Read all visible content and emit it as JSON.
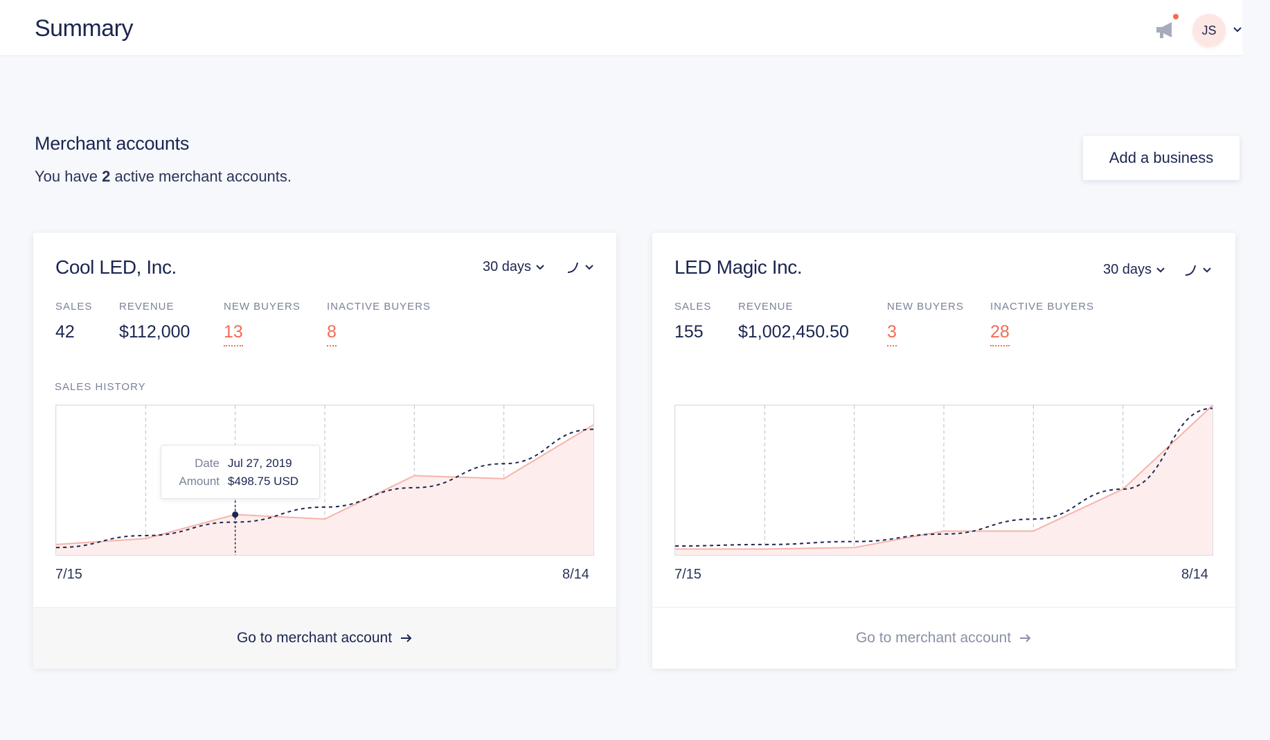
{
  "header": {
    "title": "Summary",
    "avatar_initials": "JS",
    "icons": [
      "megaphone-icon",
      "chevron-down-icon"
    ],
    "notification_color": "#f26b55"
  },
  "section": {
    "title": "Merchant accounts",
    "sub_prefix": "You have",
    "sub_count": "2",
    "sub_suffix": "active merchant accounts.",
    "add_button": "Add a business"
  },
  "colors": {
    "accent_red": "#f26b55",
    "navy": "#1b2550",
    "area_fill": "#fdeeed"
  },
  "cards": [
    {
      "name": "Cool LED, Inc.",
      "period": "30 days",
      "stats": [
        {
          "label": "SALES",
          "value": "42"
        },
        {
          "label": "REVENUE",
          "value": "$112,000"
        },
        {
          "label": "NEW BUYERS",
          "value": "13"
        },
        {
          "label": "INACTIVE BUYERS",
          "value": "8"
        }
      ],
      "history_label": "SALES HISTORY",
      "x_start": "7/15",
      "x_end": "8/14",
      "tooltip": {
        "date_label": "Date",
        "date": "Jul 27, 2019",
        "amount_label": "Amount",
        "amount": "$498.75 USD"
      },
      "footer": "Go to merchant account"
    },
    {
      "name": "LED Magic Inc.",
      "period": "30 days",
      "stats": [
        {
          "label": "SALES",
          "value": "155"
        },
        {
          "label": "REVENUE",
          "value": "$1,002,450.50"
        },
        {
          "label": "NEW BUYERS",
          "value": "3"
        },
        {
          "label": "INACTIVE BUYERS",
          "value": "28"
        }
      ],
      "x_start": "7/15",
      "x_end": "8/14",
      "footer": "Go to merchant account"
    }
  ],
  "chart_data": [
    {
      "type": "area",
      "x": [
        "7/15",
        "",
        "",
        "",
        "",
        "",
        "8/14"
      ],
      "series": [
        {
          "values": [
            0.07,
            0.11,
            0.27,
            0.24,
            0.53,
            0.51,
            0.87
          ]
        },
        {
          "values": [
            0.05,
            0.13,
            0.22,
            0.32,
            0.45,
            0.61,
            0.84
          ]
        }
      ],
      "ylim": [
        0,
        1
      ],
      "grid": "vertical dashed"
    },
    {
      "type": "area",
      "x": [
        "7/15",
        "",
        "",
        "",
        "",
        "",
        "8/14"
      ],
      "series": [
        {
          "values": [
            0.04,
            0.04,
            0.05,
            0.16,
            0.16,
            0.44,
            1.0
          ]
        },
        {
          "values": [
            0.06,
            0.07,
            0.09,
            0.14,
            0.24,
            0.44,
            0.98
          ]
        }
      ],
      "ylim": [
        0,
        1
      ],
      "grid": "vertical dashed"
    }
  ]
}
